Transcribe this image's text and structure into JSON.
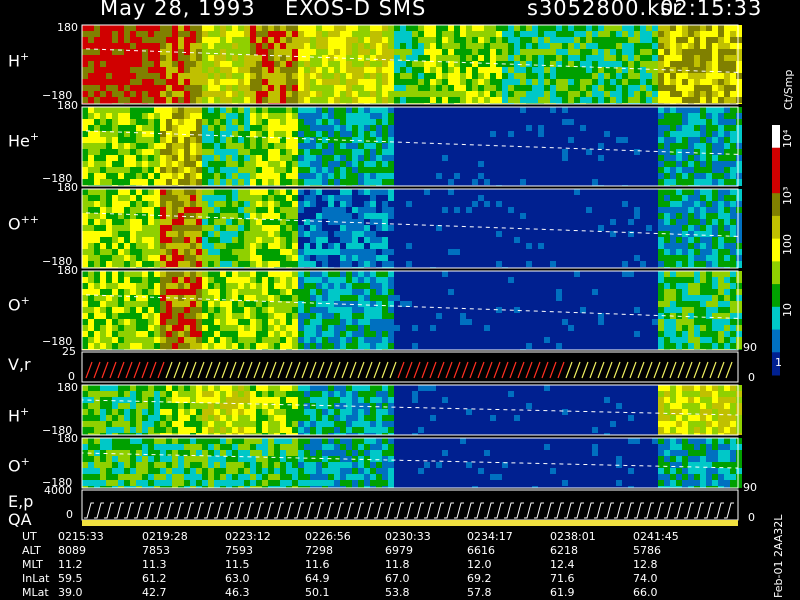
{
  "header": {
    "date": "May 28, 1993",
    "instrument": "EXOS-D SMS",
    "file": "s3052800.ksr",
    "time": "02:15:33"
  },
  "panels": [
    {
      "key": "h1",
      "label": "H",
      "sup": "+",
      "top": "180",
      "bottom": "−180"
    },
    {
      "key": "he",
      "label": "He",
      "sup": "+",
      "top": "180",
      "bottom": "−180"
    },
    {
      "key": "opp",
      "label": "O",
      "sup": "++",
      "top": "180",
      "bottom": "−180"
    },
    {
      "key": "o1",
      "label": "O",
      "sup": "+",
      "top": "180",
      "bottom": "−180"
    },
    {
      "key": "vr",
      "label": "V,r",
      "sup": "",
      "top": "25",
      "bottom": "0"
    },
    {
      "key": "h2",
      "label": "H",
      "sup": "+",
      "top": "180",
      "bottom": "−180"
    },
    {
      "key": "o2",
      "label": "O",
      "sup": "+",
      "top": "180",
      "bottom": "−180"
    },
    {
      "key": "ep",
      "label": "E,p",
      "sup": "",
      "top": "4000",
      "bottom": "0"
    }
  ],
  "qa_label": "QA",
  "right_ticks": {
    "vr_top": "90",
    "vr_bottom": "0",
    "ep_top": "90",
    "ep_bottom": "0"
  },
  "colorbar": {
    "units": "Ct/Smp",
    "ticks": [
      "10⁴",
      "10³",
      "100",
      "10",
      "1"
    ]
  },
  "footer_id": "Feb-01 2AA32L",
  "chart_data": {
    "type": "heatmap",
    "title": "May 28, 1993   EXOS-D SMS",
    "rows": [
      {
        "name": "UT",
        "values": [
          "0215:33",
          "0219:28",
          "0223:12",
          "0226:56",
          "0230:33",
          "0234:17",
          "0238:01",
          "0241:45"
        ]
      },
      {
        "name": "ALT",
        "values": [
          "8089",
          "7853",
          "7593",
          "7298",
          "6979",
          "6616",
          "6218",
          "5786"
        ]
      },
      {
        "name": "MLT",
        "values": [
          "11.2",
          "11.3",
          "11.5",
          "11.6",
          "11.8",
          "12.0",
          "12.4",
          "12.8"
        ]
      },
      {
        "name": "InLat",
        "values": [
          "59.5",
          "61.2",
          "63.0",
          "64.9",
          "67.0",
          "69.2",
          "71.6",
          "74.0"
        ]
      },
      {
        "name": "MLat",
        "values": [
          "39.0",
          "42.7",
          "46.3",
          "50.1",
          "53.8",
          "57.8",
          "61.9",
          "66.0"
        ]
      }
    ],
    "colorscale": [
      "#ffffff",
      "#d00000",
      "#808000",
      "#c0c000",
      "#ffff00",
      "#90d000",
      "#00a000",
      "#00c8c8",
      "#0070c0",
      "#002090"
    ],
    "colorbar_log_range": [
      0,
      4.5
    ]
  }
}
